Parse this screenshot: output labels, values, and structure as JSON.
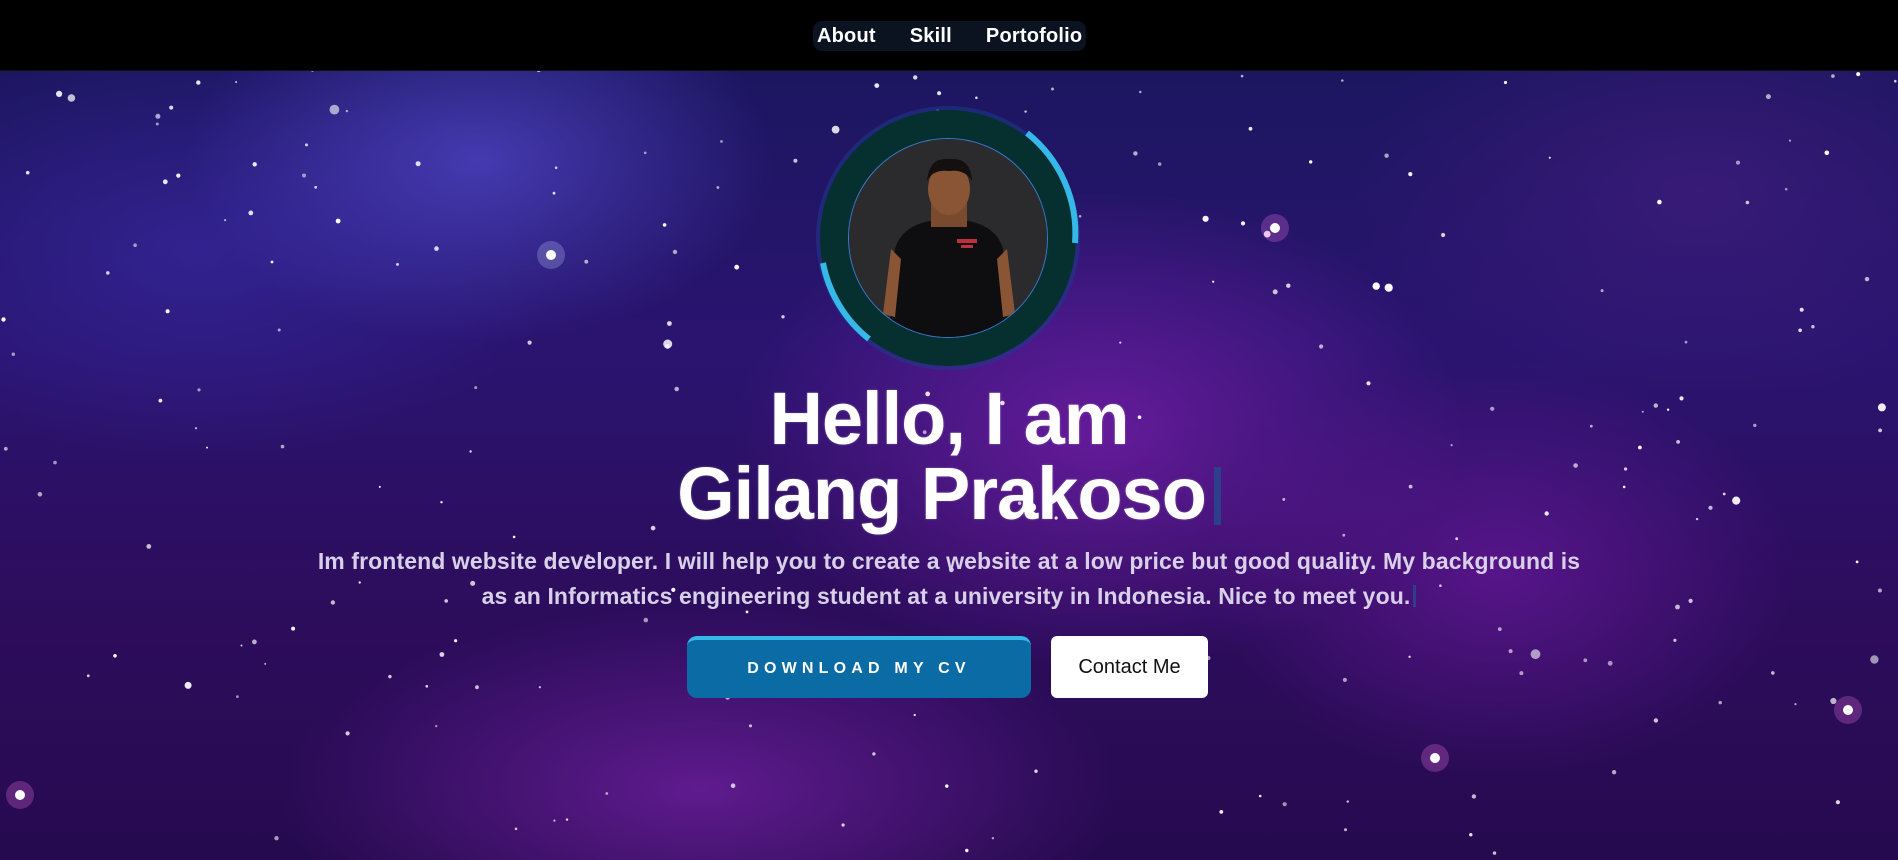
{
  "nav": {
    "items": [
      {
        "label": "About"
      },
      {
        "label": "Skill"
      },
      {
        "label": "Portofolio"
      }
    ]
  },
  "hero": {
    "title_line1": "Hello, I am",
    "title_line2": "Gilang Prakoso",
    "description": "Im frontend website developer. I will help you to create a website at a low price but good quality. My background is as an Informatics engineering student at a university in Indonesia. Nice to meet you.",
    "download_button": "Download My CV",
    "contact_button": "Contact Me"
  },
  "colors": {
    "navbar_bg": "#000000",
    "nav_pill_bg": "#0b1220",
    "hero_bg": "#2a1470",
    "avatar_ring": "#06302f",
    "avatar_accent": "#36b8e8",
    "primary_button": "#0b6ba5",
    "text_cursor": "#2d3f8a"
  }
}
